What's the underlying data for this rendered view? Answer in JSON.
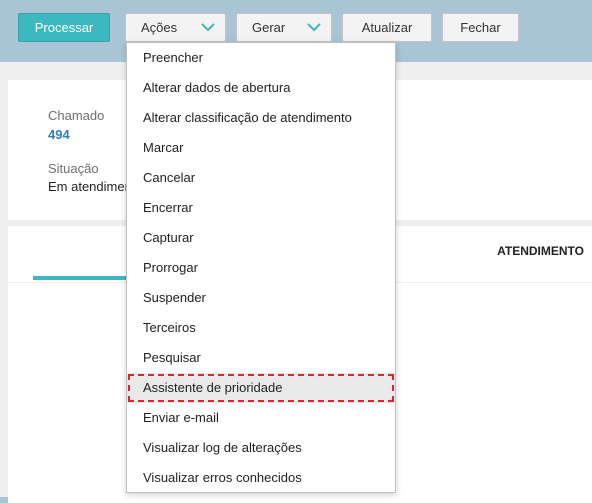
{
  "toolbar": {
    "processar_label": "Processar",
    "acoes_label": "Ações",
    "gerar_label": "Gerar",
    "atualizar_label": "Atualizar",
    "fechar_label": "Fechar",
    "colors": {
      "primary": "#3cb9be",
      "header_bg": "#a9c5d5"
    }
  },
  "details": {
    "chamado_label": "Chamado",
    "chamado_value": "494",
    "situacao_label": "Situação",
    "situacao_value": "Em atendimento"
  },
  "tabs": {
    "active_label": "ATENDIMENTO"
  },
  "menu": {
    "items": [
      {
        "label": "Preencher"
      },
      {
        "label": "Alterar dados de abertura"
      },
      {
        "label": "Alterar classificação de atendimento"
      },
      {
        "label": "Marcar"
      },
      {
        "label": "Cancelar"
      },
      {
        "label": "Encerrar"
      },
      {
        "label": "Capturar"
      },
      {
        "label": "Prorrogar"
      },
      {
        "label": "Suspender"
      },
      {
        "label": "Terceiros"
      },
      {
        "label": "Pesquisar"
      },
      {
        "label": "Assistente de prioridade",
        "highlighted": true
      },
      {
        "label": "Enviar e-mail"
      },
      {
        "label": "Visualizar log de alterações"
      },
      {
        "label": "Visualizar erros conhecidos"
      }
    ]
  }
}
